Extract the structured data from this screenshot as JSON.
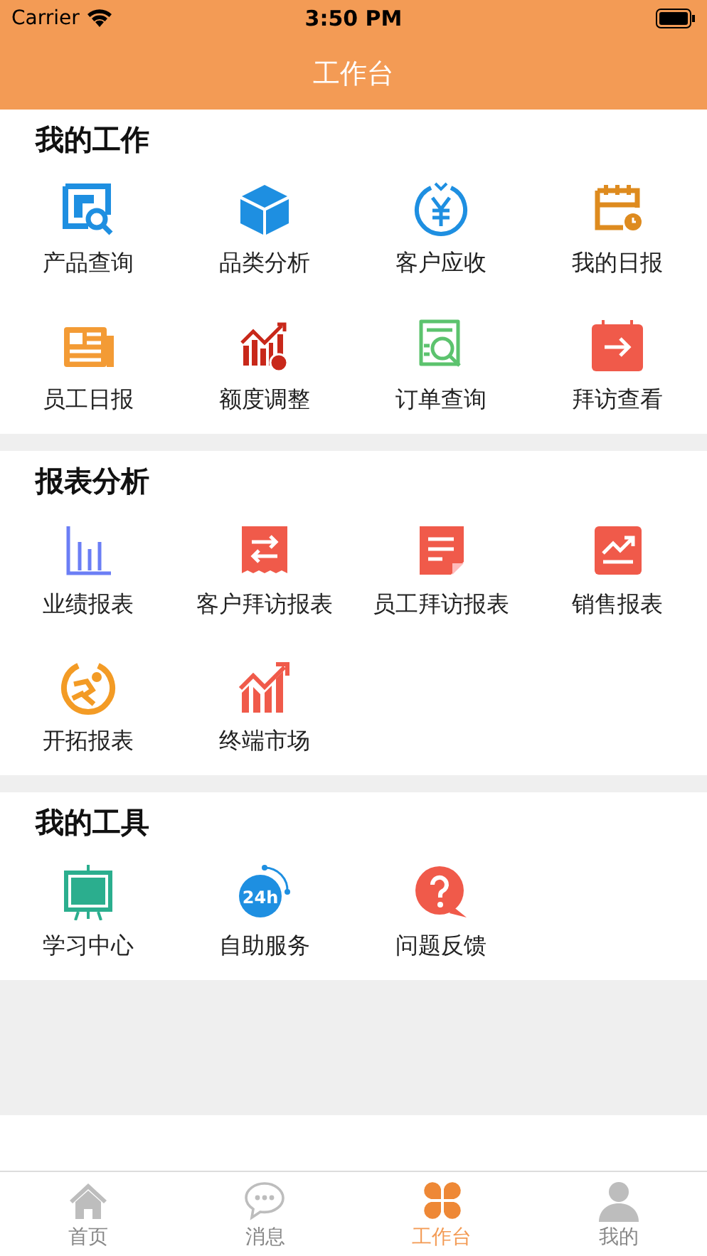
{
  "status_bar": {
    "carrier": "Carrier",
    "time": "3:50 PM"
  },
  "header": {
    "title": "工作台"
  },
  "sections": [
    {
      "title": "我的工作",
      "items": [
        {
          "label": "产品查询",
          "kind": "search-doc"
        },
        {
          "label": "品类分析",
          "kind": "cube"
        },
        {
          "label": "客户应收",
          "kind": "coin"
        },
        {
          "label": "我的日报",
          "kind": "calendar"
        },
        {
          "label": "员工日报",
          "kind": "news"
        },
        {
          "label": "额度调整",
          "kind": "bars-coin"
        },
        {
          "label": "订单查询",
          "kind": "order-search"
        },
        {
          "label": "拜访查看",
          "kind": "visit"
        }
      ]
    },
    {
      "title": "报表分析",
      "items": [
        {
          "label": "业绩报表",
          "kind": "bar-chart"
        },
        {
          "label": "客户拜访报表",
          "kind": "exchange"
        },
        {
          "label": "员工拜访报表",
          "kind": "page"
        },
        {
          "label": "销售报表",
          "kind": "trend-card"
        },
        {
          "label": "开拓报表",
          "kind": "runner"
        },
        {
          "label": "终端市场",
          "kind": "growth"
        }
      ]
    },
    {
      "title": "我的工具",
      "items": [
        {
          "label": "学习中心",
          "kind": "board"
        },
        {
          "label": "自助服务",
          "kind": "clock24",
          "icon_text": "24h"
        },
        {
          "label": "问题反馈",
          "kind": "question"
        }
      ]
    }
  ],
  "tabs": [
    {
      "label": "首页",
      "kind": "home",
      "selected": false
    },
    {
      "label": "消息",
      "kind": "chat",
      "selected": false
    },
    {
      "label": "工作台",
      "kind": "clover",
      "selected": true
    },
    {
      "label": "我的",
      "kind": "person",
      "selected": false
    }
  ]
}
